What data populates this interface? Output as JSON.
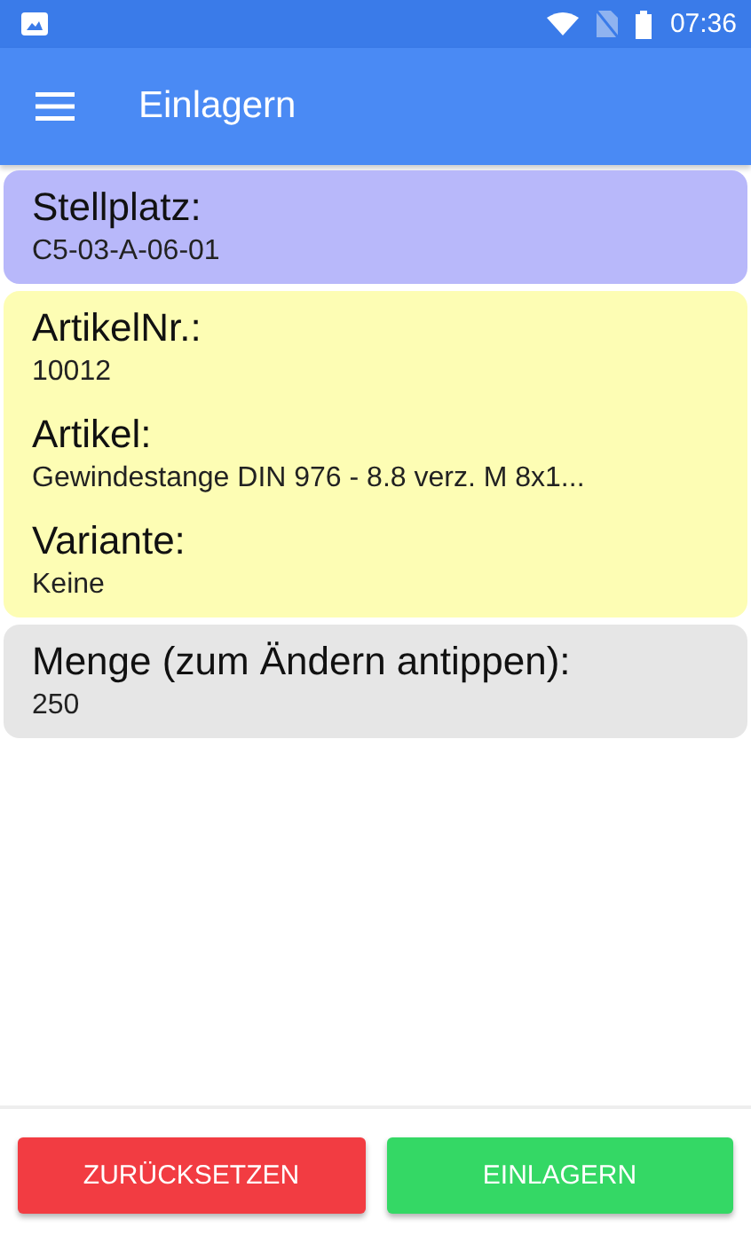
{
  "status_bar": {
    "time": "07:36"
  },
  "app_bar": {
    "title": "Einlagern"
  },
  "cards": [
    {
      "color": "#b8b8fa",
      "fields": [
        {
          "label": "Stellplatz:",
          "value": "C5-03-A-06-01"
        }
      ]
    },
    {
      "color": "#fdfdb4",
      "fields": [
        {
          "label": "ArtikelNr.:",
          "value": "10012"
        },
        {
          "label": "Artikel:",
          "value": "Gewindestange DIN 976 - 8.8 verz. M 8x1..."
        },
        {
          "label": "Variante:",
          "value": "Keine"
        }
      ]
    },
    {
      "color": "#e6e6e6",
      "fields": [
        {
          "label": "Menge (zum Ändern antippen):",
          "value": "250"
        }
      ]
    }
  ],
  "buttons": [
    {
      "label": "ZURÜCKSETZEN",
      "kind": "reset"
    },
    {
      "label": "EINLAGERN",
      "kind": "confirm"
    }
  ]
}
